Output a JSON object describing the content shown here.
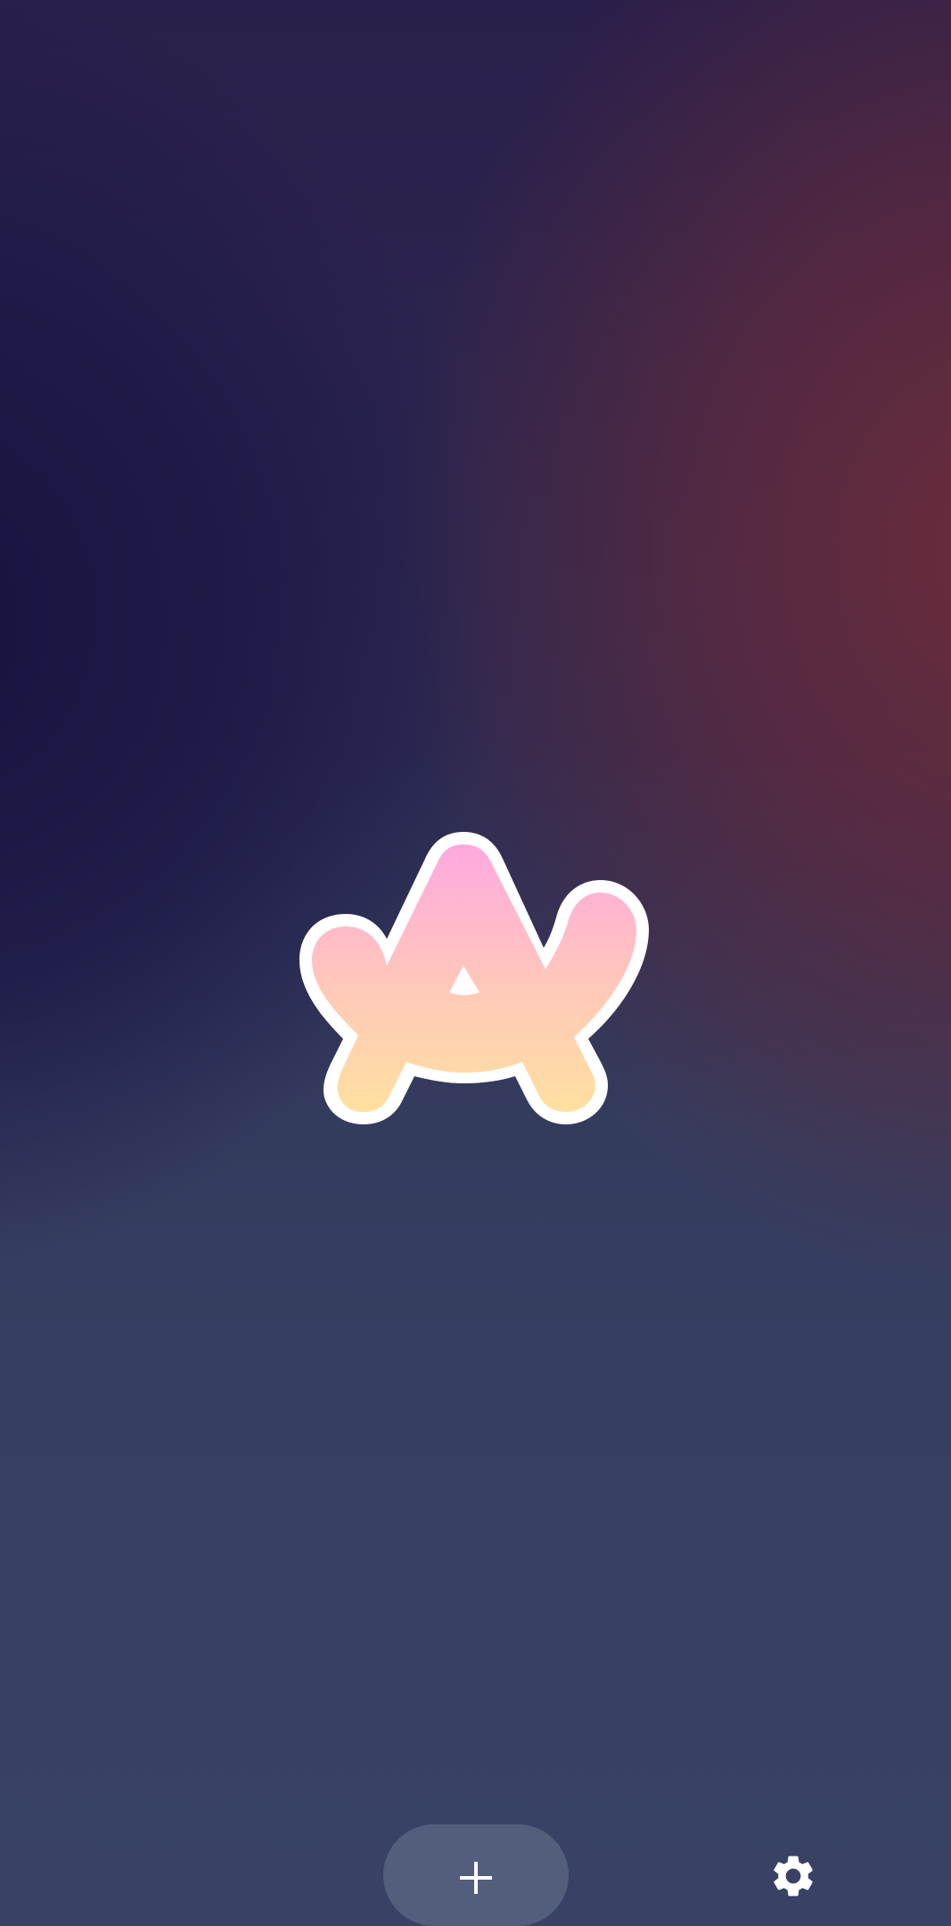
{
  "app": {
    "accent": "#ffb0dc",
    "logo_gradient": [
      "#ffa8e0",
      "#ffc9b8",
      "#ffe0a0"
    ],
    "background_colors": [
      "#1c1840",
      "#5e2c3c",
      "#394265"
    ]
  },
  "bottom_bar": {
    "add_icon": "plus-icon",
    "settings_icon": "gear-icon",
    "button_color": "#5a6482"
  }
}
